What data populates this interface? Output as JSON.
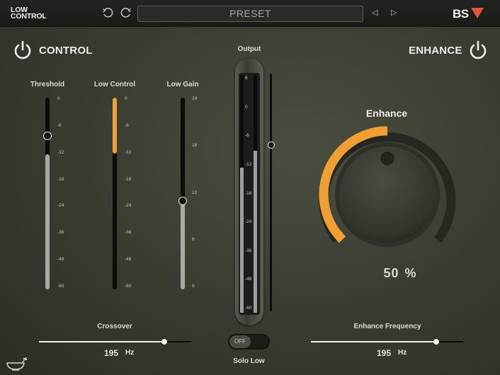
{
  "header": {
    "logo_line1": "LOW",
    "logo_line2": "CONTROL",
    "preset_label": "PRESET",
    "brand": "BS"
  },
  "control": {
    "title": "CONTROL",
    "threshold": {
      "label": "Threshold",
      "ticks": [
        "0",
        "-6",
        "-12",
        "-18",
        "-24",
        "-36",
        "-48",
        "-60"
      ],
      "value_fraction": 0.81
    },
    "low_control": {
      "label": "Low Control",
      "ticks": [
        "0",
        "-6",
        "-12",
        "-18",
        "-24",
        "-36",
        "-48",
        "-60"
      ],
      "value_fraction": 0.29
    },
    "low_gain": {
      "label": "Low Gain",
      "ticks": [
        "24",
        "18",
        "12",
        "6",
        "0"
      ],
      "value_fraction": 0.46
    }
  },
  "output": {
    "label": "Output",
    "ticks": [
      "6",
      "0",
      "-6",
      "-12",
      "-18",
      "-24",
      "-36",
      "-48",
      "-60"
    ],
    "left_level_fraction": 0.61,
    "right_level_fraction": 0.66,
    "fader_fraction": 0.72
  },
  "enhance": {
    "title": "ENHANCE",
    "knob_label": "Enhance",
    "value": "50",
    "unit": "%",
    "value_fraction": 0.5
  },
  "crossover": {
    "label": "Crossover",
    "value": "195",
    "unit": "Hz",
    "fraction": 0.82
  },
  "enhance_frequency": {
    "label": "Enhance Frequency",
    "value": "195",
    "unit": "Hz",
    "fraction": 0.82
  },
  "solo_low": {
    "label": "Solo Low",
    "state": "OFF"
  },
  "colors": {
    "accent": "#f0a033",
    "brand_red": "#e0553b",
    "background": "#3c3e33"
  },
  "icons": [
    "undo-icon",
    "redo-icon",
    "power-icon",
    "bowl-icon"
  ]
}
